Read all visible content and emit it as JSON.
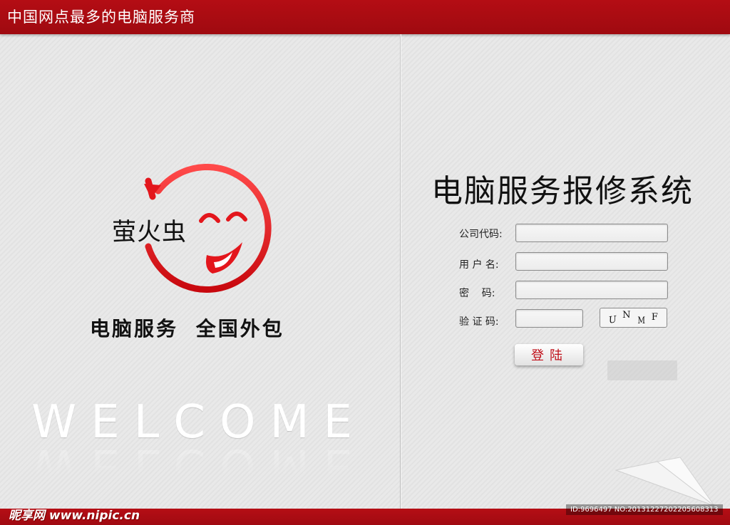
{
  "header": {
    "title": "中国网点最多的电脑服务商"
  },
  "brand": {
    "name": "萤火虫",
    "tagline": "电脑服务  全国外包",
    "welcome": "WELCOME"
  },
  "login": {
    "system_title": "电脑服务报修系统",
    "company_code_label": "公司代码:",
    "username_label": "用 户 名:",
    "password_label": "密    码:",
    "captcha_label": "验 证 码:",
    "captcha_chars": [
      "U",
      "N",
      "M",
      "F"
    ],
    "submit_label": "登陆"
  },
  "footer": {
    "site_watermark": "昵享网 www.nipic.cn",
    "image_id": "ID:9696497 NO:20131227202205608313"
  },
  "colors": {
    "accent": "#b40d14",
    "logo_red": "#e3161c"
  },
  "icons": {
    "logo": "smiley-arrow-logo-icon",
    "plane": "paper-plane-icon"
  }
}
